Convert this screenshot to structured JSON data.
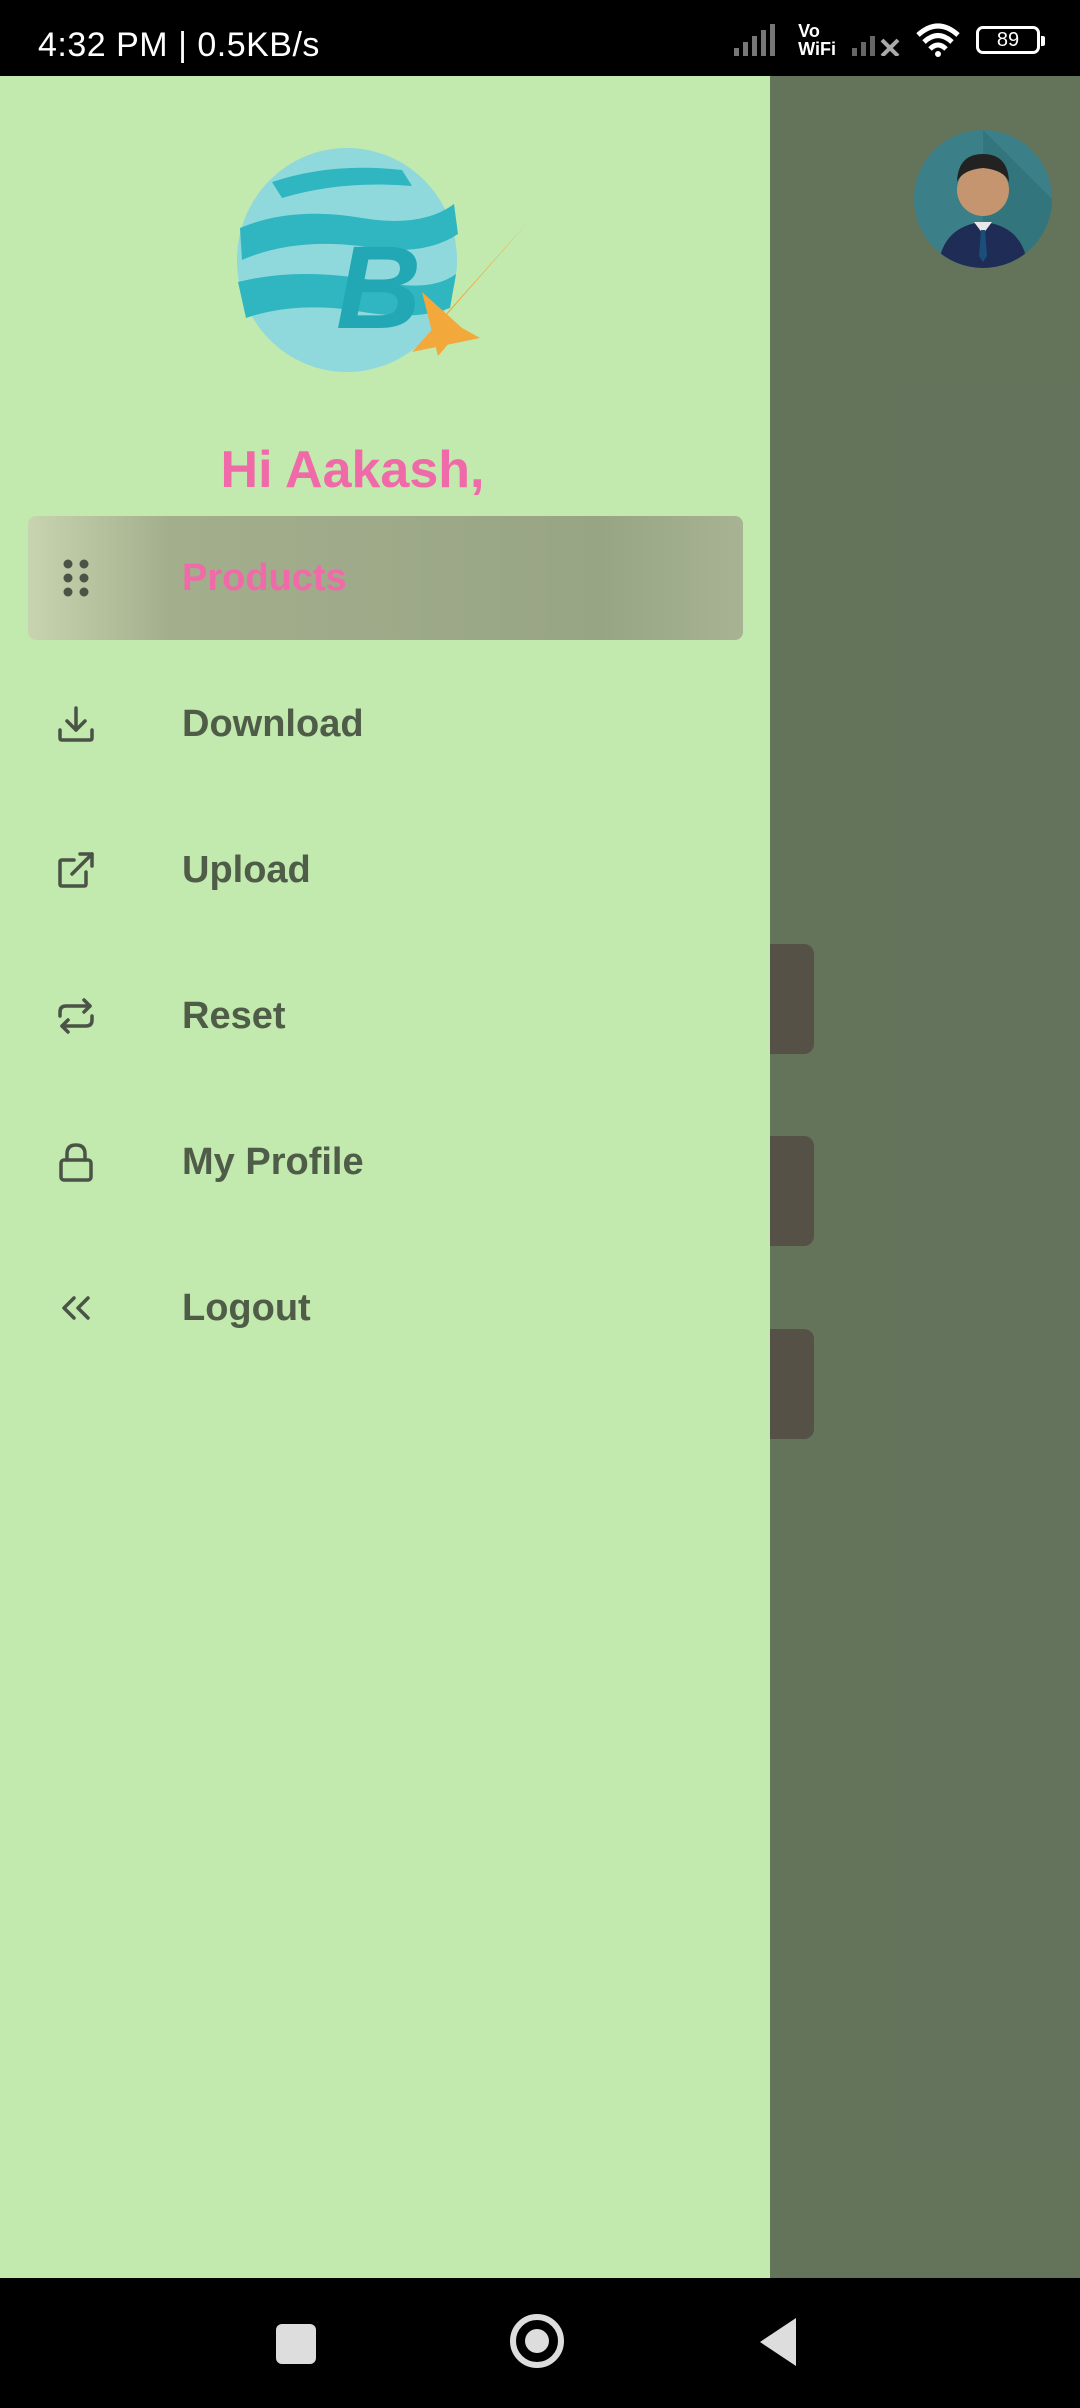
{
  "status_bar": {
    "time_speed": "4:32 PM | 0.5KB/s",
    "vowifi_top": "Vo",
    "vowifi_bottom": "WiFi",
    "battery": "89"
  },
  "drawer": {
    "greeting": "Hi Aakash,",
    "logo_icon": "bx-globe-logo",
    "items": [
      {
        "label": "Products",
        "icon": "grid-dots-icon",
        "active": true
      },
      {
        "label": "Download",
        "icon": "download-icon",
        "active": false
      },
      {
        "label": "Upload",
        "icon": "external-link-icon",
        "active": false
      },
      {
        "label": "Reset",
        "icon": "repeat-icon",
        "active": false
      },
      {
        "label": "My Profile",
        "icon": "lock-icon",
        "active": false
      },
      {
        "label": "Logout",
        "icon": "chevrons-left-icon",
        "active": false
      }
    ]
  },
  "colors": {
    "drawer_bg": "#c2e9ae",
    "accent_pink": "#f06aa9",
    "label_text": "#4f5c48",
    "bg_card": "#8a3764"
  },
  "navigation": {
    "recent_icon": "square-icon",
    "home_icon": "circle-icon",
    "back_icon": "triangle-back-icon"
  }
}
